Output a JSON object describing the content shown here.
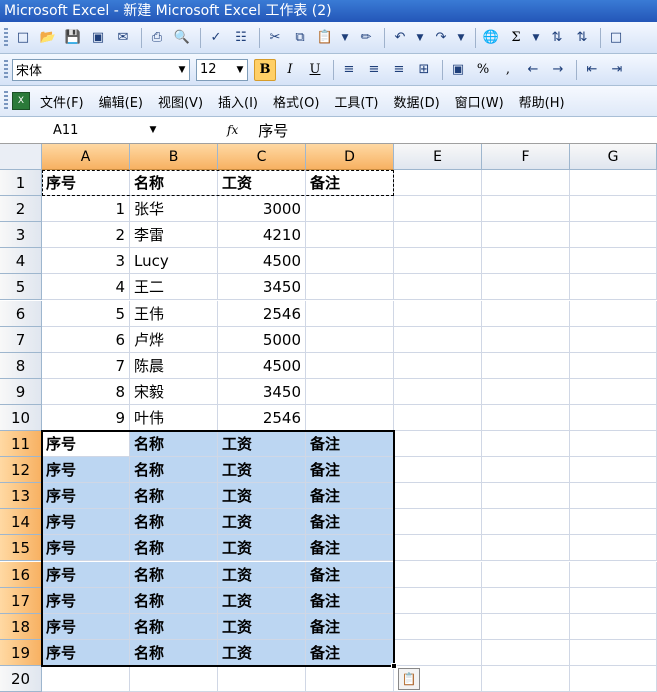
{
  "window": {
    "title": "Microsoft Excel - 新建 Microsoft Excel 工作表 (2)"
  },
  "format_toolbar": {
    "font_name": "宋体",
    "font_size": "12",
    "bold": "B",
    "italic": "I",
    "underline": "U",
    "percent": "%",
    "comma": ",",
    "sum": "Σ"
  },
  "menu": {
    "items": [
      "文件(F)",
      "编辑(E)",
      "视图(V)",
      "插入(I)",
      "格式(O)",
      "工具(T)",
      "数据(D)",
      "窗口(W)",
      "帮助(H)"
    ]
  },
  "formula_bar": {
    "name_box": "A11",
    "fx": "fx",
    "content": "序号"
  },
  "columns": [
    "A",
    "B",
    "C",
    "D",
    "E",
    "F",
    "G"
  ],
  "rows": [
    "1",
    "2",
    "3",
    "4",
    "5",
    "6",
    "7",
    "8",
    "9",
    "10",
    "11",
    "12",
    "13",
    "14",
    "15",
    "16",
    "17",
    "18",
    "19",
    "20"
  ],
  "cells": [
    [
      "序号",
      "名称",
      "工资",
      "备注"
    ],
    [
      "1",
      "张华",
      "3000",
      ""
    ],
    [
      "2",
      "李雷",
      "4210",
      ""
    ],
    [
      "3",
      "Lucy",
      "4500",
      ""
    ],
    [
      "4",
      "王二",
      "3450",
      ""
    ],
    [
      "5",
      "王伟",
      "2546",
      ""
    ],
    [
      "6",
      "卢烨",
      "5000",
      ""
    ],
    [
      "7",
      "陈晨",
      "4500",
      ""
    ],
    [
      "8",
      "宋毅",
      "3450",
      ""
    ],
    [
      "9",
      "叶伟",
      "2546",
      ""
    ],
    [
      "序号",
      "名称",
      "工资",
      "备注"
    ],
    [
      "序号",
      "名称",
      "工资",
      "备注"
    ],
    [
      "序号",
      "名称",
      "工资",
      "备注"
    ],
    [
      "序号",
      "名称",
      "工资",
      "备注"
    ],
    [
      "序号",
      "名称",
      "工资",
      "备注"
    ],
    [
      "序号",
      "名称",
      "工资",
      "备注"
    ],
    [
      "序号",
      "名称",
      "工资",
      "备注"
    ],
    [
      "序号",
      "名称",
      "工资",
      "备注"
    ],
    [
      "序号",
      "名称",
      "工资",
      "备注"
    ],
    [
      "",
      "",
      "",
      ""
    ]
  ],
  "colors": {
    "selection": "#bcd6f2",
    "header_selected": "#f7b162"
  }
}
